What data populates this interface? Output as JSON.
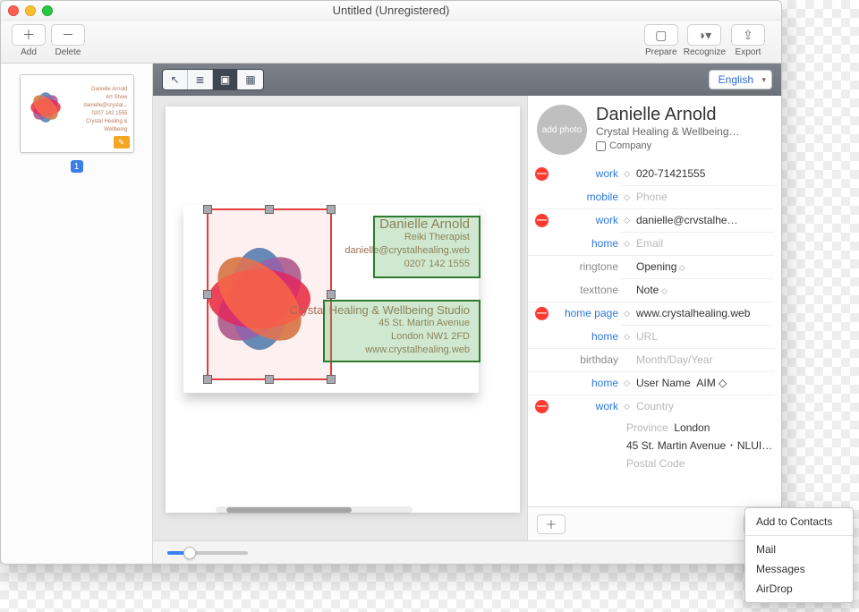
{
  "window": {
    "title": "Untitled (Unregistered)"
  },
  "toolbar": {
    "add": "Add",
    "delete": "Delete",
    "prepare": "Prepare",
    "recognize": "Recognize",
    "export": "Export"
  },
  "sidebar": {
    "page_number": "1",
    "thumb_lines": [
      "Danielle Arnold",
      "Art Show",
      "danielle@crystal...",
      "0207 142 1555",
      "Crystal Healing & Wellbeing"
    ]
  },
  "language": "English",
  "card_preview": {
    "name": "Danielle Arnold",
    "role": "Reiki Therapist",
    "email": "danielle@crystalhealing.web",
    "phone": "0207 142 1555",
    "company": "Crystal Healing & Wellbeing Studio",
    "street": "45 St. Martin Avenue",
    "city": "London NW1 2FD",
    "web": "www.crystalhealing.web"
  },
  "contact": {
    "avatar_label": "add photo",
    "name": "Danielle Arnold",
    "subtitle": "Crystal Healing & Wellbeing…",
    "company_label": "Company",
    "fields": {
      "phone_work_label": "work",
      "phone_work_value": "020-71421555",
      "phone_mobile_label": "mobile",
      "phone_mobile_placeholder": "Phone",
      "email_work_label": "work",
      "email_work_value": "danielle@crvstalhe…",
      "email_home_label": "home",
      "email_home_placeholder": "Email",
      "ringtone_label": "ringtone",
      "ringtone_value": "Opening",
      "texttone_label": "texttone",
      "texttone_value": "Note",
      "homepage_label": "home page",
      "homepage_value": "www.crystalhealing.web",
      "url_home_label": "home",
      "url_home_placeholder": "URL",
      "birthday_label": "birthday",
      "birthday_placeholder": "Month/Day/Year",
      "social_home_label": "home",
      "social_username_placeholder": "User Name",
      "social_service": "AIM",
      "addr_label": "work",
      "addr_country_placeholder": "Country",
      "addr_province_placeholder": "Province",
      "addr_city": "London",
      "addr_street": "45 St. Martin Avenue ･ NLUI…",
      "addr_postal_placeholder": "Postal Code"
    }
  },
  "share_menu": {
    "add_to_contacts": "Add to Contacts",
    "mail": "Mail",
    "messages": "Messages",
    "airdrop": "AirDrop"
  }
}
